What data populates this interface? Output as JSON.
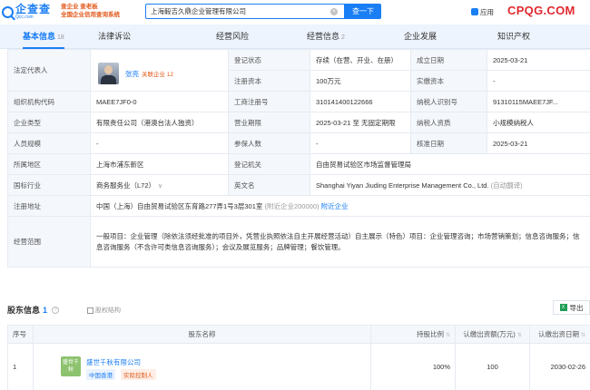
{
  "header": {
    "logo_cn": "企查查",
    "logo_url": "Qcc.com",
    "slogan_line1": "查企业 查老板",
    "slogan_line2": "全国企业信用查询系统",
    "search_value": "上海毅吉久鼎企业管理有限公司",
    "search_button": "查一下",
    "app_label": "应用",
    "watermark": "CPQG.COM"
  },
  "tabs": [
    {
      "label": "基本信息",
      "count": "18"
    },
    {
      "label": "法律诉讼",
      "count": ""
    },
    {
      "label": "经营风险",
      "count": ""
    },
    {
      "label": "经营信息",
      "count": "2"
    },
    {
      "label": "企业发展",
      "count": ""
    },
    {
      "label": "知识产权",
      "count": ""
    }
  ],
  "info": {
    "legal_rep_label": "法定代表人",
    "legal_rep_name": "张亮",
    "assoc_label": "关联企业",
    "assoc_count": "12",
    "reg_status_label": "登记状态",
    "reg_status": "存续（在营、开业、在册）",
    "established_label": "成立日期",
    "established": "2025-03-21",
    "reg_capital_label": "注册资本",
    "reg_capital": "100万元",
    "paid_capital_label": "实缴资本",
    "paid_capital": "-",
    "org_code_label": "组织机构代码",
    "org_code": "MAEE7JF0-0",
    "biz_reg_no_label": "工商注册号",
    "biz_reg_no": "310141400122666",
    "taxpayer_id_label": "纳税人识别号",
    "taxpayer_id": "91310115MAEE7JF...",
    "company_type_label": "企业类型",
    "company_type": "有限责任公司（港澳台法人独资）",
    "biz_term_label": "营业期限",
    "biz_term": "2025-03-21 至 无固定期限",
    "taxpayer_qual_label": "纳税人资质",
    "taxpayer_qual": "小规模纳税人",
    "staff_size_label": "人员规模",
    "staff_size": "-",
    "insured_label": "参保人数",
    "insured": "-",
    "approval_date_label": "核准日期",
    "approval_date": "2025-03-21",
    "region_label": "所属地区",
    "region": "上海市浦东新区",
    "reg_authority_label": "登记机关",
    "reg_authority": "自由贸易试验区市场监督管理局",
    "industry_label": "国标行业",
    "industry": "商务服务业（L72）",
    "english_name_label": "英文名",
    "english_name": "Shanghai Yiyan Jiuding Enterprise Management Co., Ltd.",
    "english_name_note": "(自动翻译)",
    "address_label": "注册地址",
    "address": "中国（上海）自由贸易试验区东育路277弄1号3层301室",
    "address_nearby_count": "(附近企业200000)",
    "address_nearby_link": "附近企业",
    "scope_label": "经营范围",
    "scope": "一般项目：企业管理（除依法须经批准的项目外，凭营业执照依法自主开展经营活动）自主展示（特色）项目：企业管理咨询；市场营销策划；信息咨询服务；信息咨询服务（不含许可类信息咨询服务）；会议及展览服务；品牌管理；餐饮管理。"
  },
  "shareholders": {
    "title": "股东信息",
    "count": "1",
    "structure_link": "股权结构",
    "export_label": "导出",
    "columns": [
      "序号",
      "股东名称",
      "持股比例",
      "认缴出资额(万元)",
      "认缴出资日期"
    ],
    "rows": [
      {
        "index": "1",
        "logo_text": "盛世千秋",
        "name": "盛世千秋有限公司",
        "tag_region": "中国香港",
        "tag_control": "实际控制人",
        "ratio": "100%",
        "amount": "100",
        "date": "2030-02-26"
      }
    ]
  }
}
